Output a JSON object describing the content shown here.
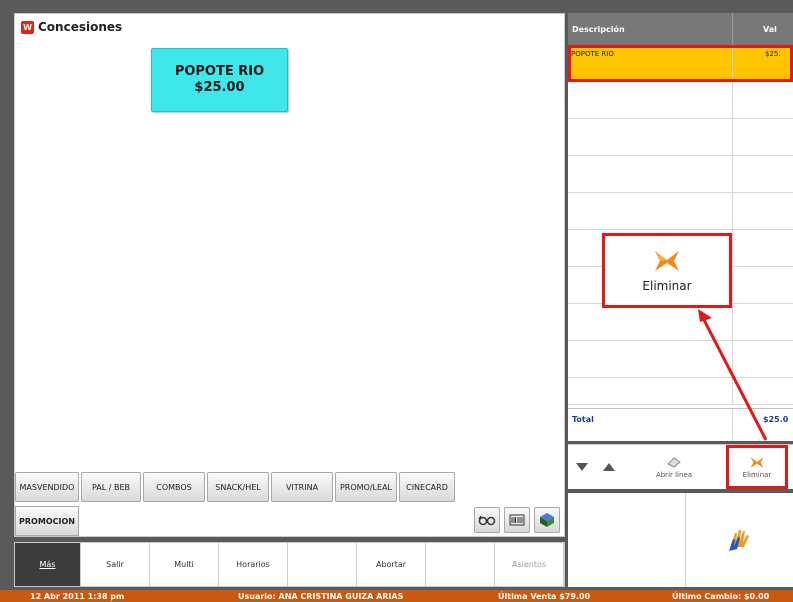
{
  "window": {
    "title": "Concesiones"
  },
  "product": {
    "name": "POPOTE RIO",
    "price": "$25.00"
  },
  "categories": [
    "MASVENDIDO",
    "PAL / BEB",
    "COMBOS",
    "SNACK/HEL",
    "VITRINA",
    "PROMO/LEAL",
    "CINECARD"
  ],
  "promo_label": "PROMOCION",
  "func_bar": {
    "mas": "Más",
    "salir": "Salir",
    "multi": "Multi",
    "horarios": "Horarios",
    "abortar": "Abortar",
    "asientos": "Asientos"
  },
  "ticket": {
    "col_desc": "Descripción",
    "col_value": "Val",
    "item_desc": "POPOTE RIO",
    "item_value": "$25.",
    "total_label": "Total",
    "total_value": "$25.0"
  },
  "callout": {
    "label": "Eliminar"
  },
  "controls": {
    "abrir": "Abrir línea",
    "eliminar": "Eliminar"
  },
  "status": {
    "datetime": "12 Abr 2011 1:38 pm",
    "usuario": "Usuario: ANA CRISTINA GUIZA ARIAS",
    "ultima_venta": "Última Venta $79.00",
    "ultimo_cambio": "Último Cambio: $0.00"
  },
  "colors": {
    "tile": "#3fe6ea",
    "highlight_row": "#ffc400",
    "annotation_red": "#e01919",
    "status_bar": "#c75a10"
  }
}
